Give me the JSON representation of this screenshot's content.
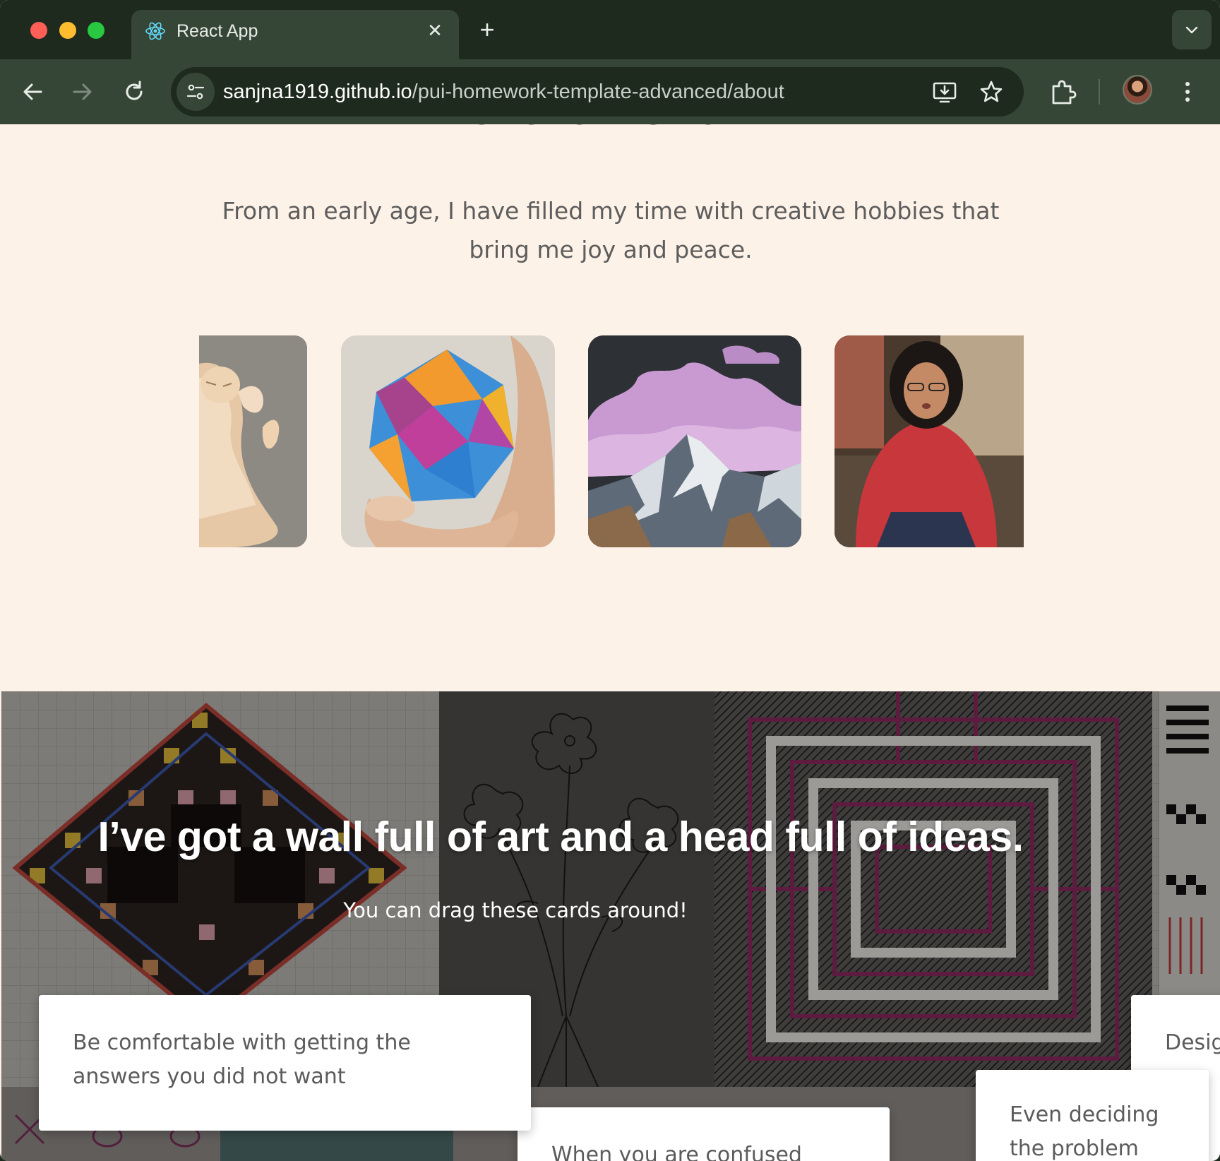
{
  "browser": {
    "tab_title": "React App",
    "tab_close": "✕",
    "new_tab": "+",
    "url_host": "sanjna1919.github.io",
    "url_path": "/pui-homework-template-advanced/about"
  },
  "hobbies": {
    "title_fragment": "entire world?",
    "text": "From an early age, I have filled my time with creative hobbies that bring me joy and peace.",
    "photos": [
      "cat",
      "origami ball",
      "mountain painting",
      "singing"
    ]
  },
  "art": {
    "title": "I’ve got a wall full of art and a head full of ideas.",
    "subtitle": "You can drag these cards around!",
    "cards": [
      "Be comfortable with getting the answers you did not want",
      "When you are confused",
      "Even deciding the problem",
      "Desig u ro"
    ]
  },
  "colors": {
    "chrome_dark": "#1e2a1e",
    "chrome_tab": "#364636",
    "page_bg": "#fdf2e8",
    "text_dark": "#3a3a3a",
    "text_muted": "#5d5d5d"
  }
}
